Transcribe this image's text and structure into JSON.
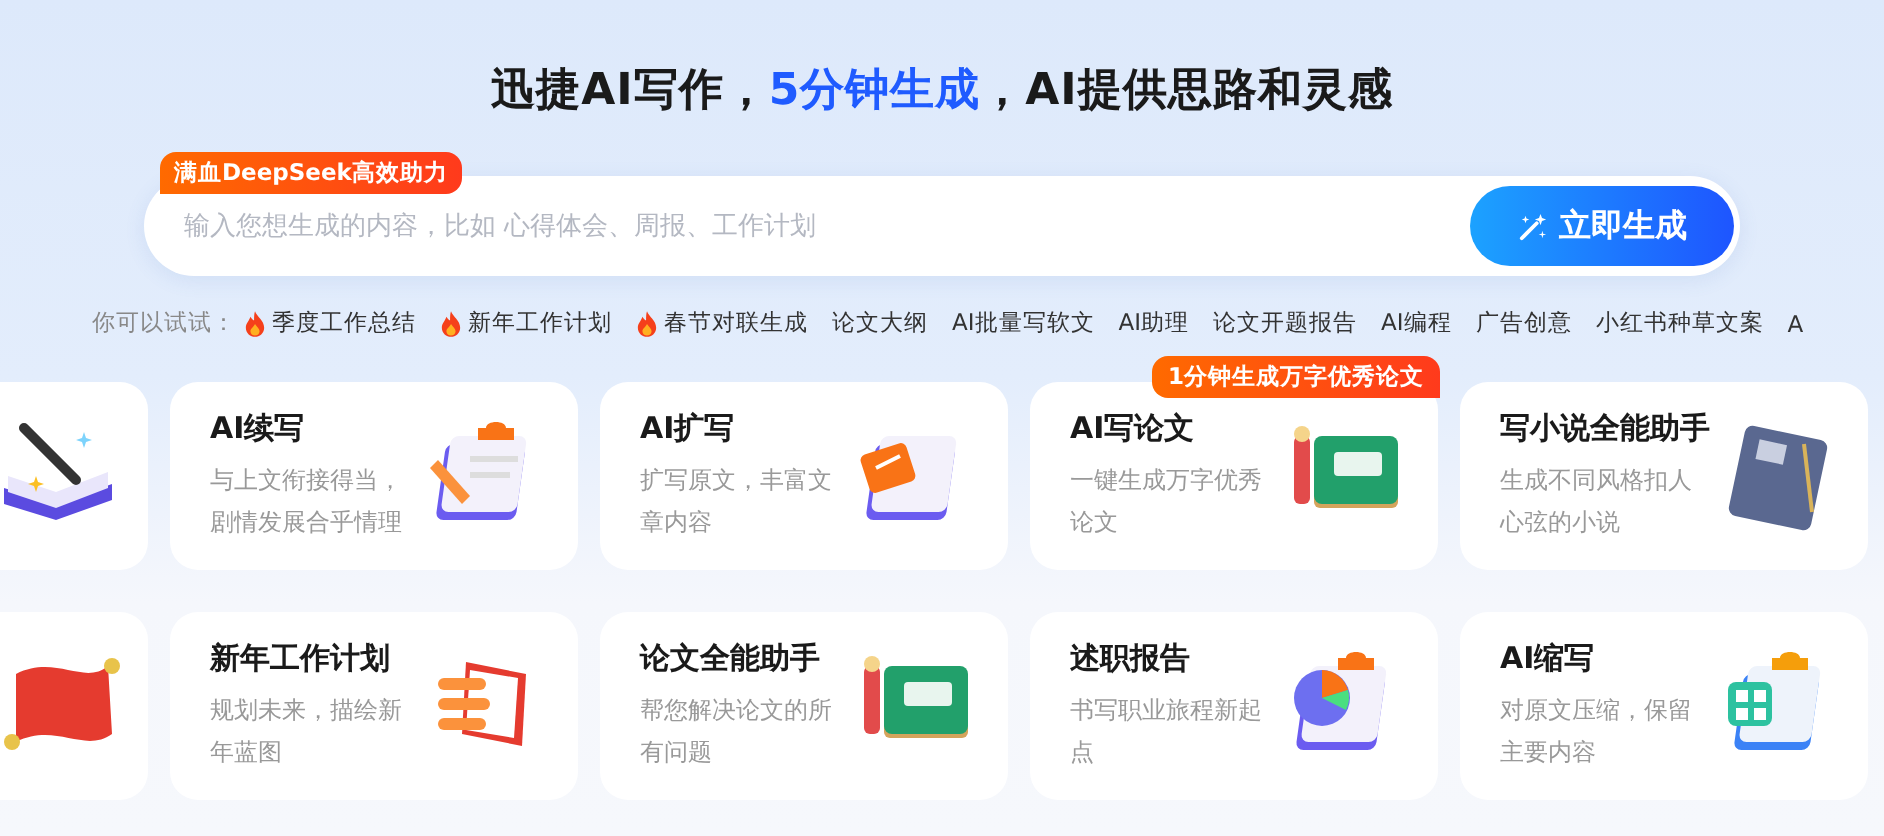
{
  "headline": [
    {
      "text": "迅捷AI写作，",
      "highlight": false
    },
    {
      "text": "5分钟生成",
      "highlight": true
    },
    {
      "text": "，AI提供思路和灵感",
      "highlight": false
    }
  ],
  "search": {
    "badge": "满血DeepSeek高效助力",
    "placeholder": "输入您想生成的内容，比如 心得体会、周报、工作计划",
    "button": "立即生成"
  },
  "suggestions": {
    "label": "你可以试试：",
    "items": [
      {
        "text": "季度工作总结",
        "hot": true
      },
      {
        "text": "新年工作计划",
        "hot": true
      },
      {
        "text": "春节对联生成",
        "hot": true
      },
      {
        "text": "论文大纲",
        "hot": false
      },
      {
        "text": "AI批量写软文",
        "hot": false
      },
      {
        "text": "AI助理",
        "hot": false
      },
      {
        "text": "论文开题报告",
        "hot": false
      },
      {
        "text": "AI编程",
        "hot": false
      },
      {
        "text": "广告创意",
        "hot": false
      },
      {
        "text": "小红书种草文案",
        "hot": false
      },
      {
        "text": "A",
        "hot": false
      }
    ]
  },
  "cards": [
    {
      "kind": "partial"
    },
    {
      "kind": "tool",
      "title": "AI续写",
      "description": "与上文衔接得当，剧情发展合乎情理"
    },
    {
      "kind": "tool",
      "title": "AI扩写",
      "description": "扩写原文，丰富文章内容"
    },
    {
      "kind": "tool",
      "title": "AI写论文",
      "description": "一键生成万字优秀论文",
      "ribbon": "1分钟生成万字优秀论文"
    },
    {
      "kind": "tool",
      "title": "写小说全能助手",
      "description": "生成不同风格扣人心弦的小说"
    },
    {
      "kind": "partial"
    },
    {
      "kind": "tool",
      "title": "新年工作计划",
      "description": "规划未来，描绘新年蓝图"
    },
    {
      "kind": "tool",
      "title": "论文全能助手",
      "description": "帮您解决论文的所有问题"
    },
    {
      "kind": "tool",
      "title": "述职报告",
      "description": "书写职业旅程新起点"
    },
    {
      "kind": "tool",
      "title": "AI缩写",
      "description": "对原文压缩，保留主要内容"
    }
  ]
}
